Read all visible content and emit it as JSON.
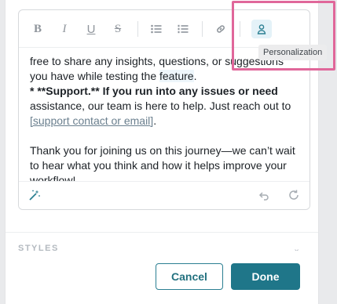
{
  "toolbar": {
    "bold_label": "B",
    "italic_label": "I",
    "underline_label": "U",
    "strike_label": "S",
    "icons": [
      "bullet-list-icon",
      "numbered-list-icon",
      "link-icon",
      "person-icon"
    ]
  },
  "tooltip": {
    "text": "Personalization"
  },
  "content": {
    "line1": "free to share any insights, questions, or suggestions",
    "line2_pre": "you have while testing the ",
    "line2_hl": "feature",
    "line2_post": ".",
    "support_bullet": "* **Support.** If you run into any issues or need",
    "line4": "assistance, our team is here to help. Just reach out to",
    "link_text": "[support contact or email]",
    "link_post": ".",
    "line6": "Thank you for joining us on this journey—we can’t wait",
    "line7": "to hear what you think and how it helps improve your",
    "line8": "workflow!"
  },
  "styles": {
    "label": "STYLES"
  },
  "footer": {
    "cancel_label": "Cancel",
    "done_label": "Done"
  },
  "colors": {
    "accent": "#1f7689",
    "highlight_border": "#e0679a",
    "active_button_bg": "#e4f2f8"
  }
}
